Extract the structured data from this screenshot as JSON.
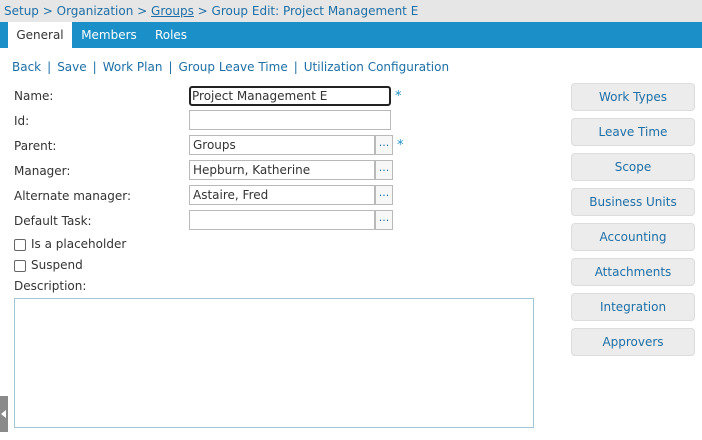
{
  "breadcrumb": {
    "setup": "Setup",
    "sep1": " > ",
    "organization": "Organization",
    "sep2": " > ",
    "groups": "Groups",
    "sep3": " > ",
    "current": "Group Edit: Project Management E"
  },
  "tabs": [
    {
      "label": "General",
      "active": true
    },
    {
      "label": "Members",
      "active": false
    },
    {
      "label": "Roles",
      "active": false
    }
  ],
  "toolbar": {
    "back": "Back",
    "save": "Save",
    "work_plan": "Work Plan",
    "group_leave_time": "Group Leave Time",
    "utilization_configuration": "Utilization Configuration",
    "separator": "|"
  },
  "form": {
    "name": {
      "label": "Name:",
      "value": "Project Management E",
      "required": true
    },
    "id": {
      "label": "Id:",
      "value": ""
    },
    "parent": {
      "label": "Parent:",
      "value": "Groups",
      "required": true
    },
    "manager": {
      "label": "Manager:",
      "value": "Hepburn, Katherine"
    },
    "alternate_manager": {
      "label": "Alternate manager:",
      "value": "Astaire, Fred"
    },
    "default_task": {
      "label": "Default Task:",
      "value": ""
    },
    "is_placeholder": {
      "label": "Is a placeholder",
      "checked": false
    },
    "suspend": {
      "label": "Suspend",
      "checked": false
    },
    "description": {
      "label": "Description:",
      "value": ""
    },
    "lookup_glyph": "...",
    "required_mark": "*"
  },
  "side_buttons": [
    "Work Types",
    "Leave Time",
    "Scope",
    "Business Units",
    "Accounting",
    "Attachments",
    "Integration",
    "Approvers"
  ],
  "colors": {
    "tab_bar": "#1b8fc8",
    "link": "#1e6fa6",
    "breadcrumb_bg": "#e6e6e6",
    "side_button_bg": "#ececec"
  }
}
